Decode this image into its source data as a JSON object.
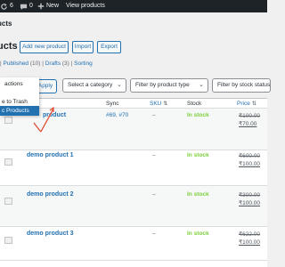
{
  "adminbar": {
    "updates_count": "6",
    "comments_count": "0",
    "new_label": "New",
    "view_products_label": "View products",
    "icons": [
      "refresh-icon",
      "comment-icon",
      "plus-icon"
    ]
  },
  "breadcrumb_title": "ucts",
  "header": {
    "heading": "ucts",
    "add_new_label": "Add new product",
    "import_label": "Import",
    "export_label": "Export"
  },
  "filters": {
    "segments": [
      {
        "text": "| ",
        "link": false
      },
      {
        "text": "Published",
        "link": true
      },
      {
        "text": " (10) | ",
        "link": false
      },
      {
        "text": "Drafts",
        "link": true
      },
      {
        "text": " (3) | ",
        "link": false
      },
      {
        "text": "Sorting",
        "link": true
      }
    ]
  },
  "bulk_actions": {
    "options": [
      "actions",
      "e to Trash",
      "c Products"
    ],
    "selected_index": 2,
    "apply_label": "Apply"
  },
  "dropdowns": {
    "category": "Select a category",
    "product_type": "Filter by product type",
    "stock_status": "Filter by stock status"
  },
  "table": {
    "headers": {
      "sync": "Sync",
      "sku": "SKU",
      "stock": "Stock",
      "price": "Price"
    },
    "rows": [
      {
        "name": "product",
        "sync": "#69, #70",
        "sku": "–",
        "stock": "In stock",
        "price_old": "₹100.00",
        "price_new": "₹70.00"
      },
      {
        "name": "demo product 1",
        "sync": "",
        "sku": "–",
        "stock": "In stock",
        "price_old": "₹600.00",
        "price_new": "₹100.00"
      },
      {
        "name": "demo product 2",
        "sync": "",
        "sku": "–",
        "stock": "In stock",
        "price_old": "₹300.00",
        "price_new": "₹100.00"
      },
      {
        "name": "demo product 3",
        "sync": "",
        "sku": "–",
        "stock": "In stock",
        "price_old": "₹622.00",
        "price_new": "₹100.00"
      }
    ]
  },
  "colors": {
    "accent": "#2271b1",
    "in_stock": "#7ad03a",
    "admin_bar": "#1d2327",
    "annotation_arrow": "#e0452b"
  }
}
